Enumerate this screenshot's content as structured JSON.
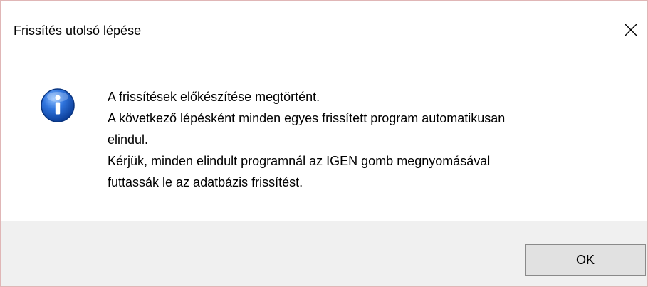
{
  "window": {
    "title": "Frissítés utolsó lépése",
    "close_icon": "close-icon"
  },
  "message": {
    "icon": "info-icon",
    "icon_color": "#1a5fc8",
    "lines": [
      "A frissítések előkészítése megtörtént.",
      "A következő lépésként minden egyes frissített program automatikusan",
      "elindul.",
      "Kérjük, minden elindult programnál az IGEN gomb megnyomásával",
      "futtassák le az adatbázis frissítést."
    ]
  },
  "footer": {
    "ok_label": "OK"
  }
}
